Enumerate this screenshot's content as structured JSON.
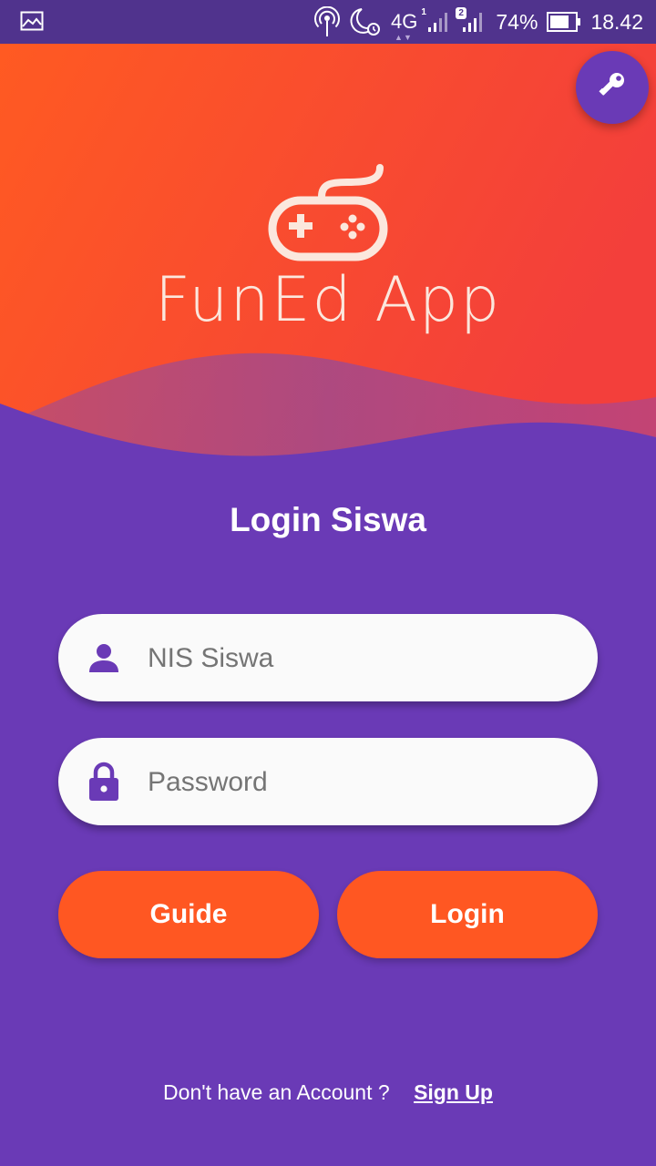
{
  "status_bar": {
    "network": "4G",
    "sim1": "1",
    "sim2": "2",
    "battery": "74%",
    "time": "18.42",
    "icons": [
      "image-icon",
      "hotspot-icon",
      "moon-alarm-icon",
      "signal-icon",
      "battery-icon"
    ]
  },
  "header": {
    "app_name": "FunEd App",
    "logo_icon": "gamepad-icon",
    "fab_icon": "key-icon"
  },
  "login": {
    "title": "Login Siswa",
    "nis_placeholder": "NIS Siswa",
    "password_placeholder": "Password",
    "guide_label": "Guide",
    "login_label": "Login"
  },
  "footer": {
    "prompt": "Don't have an Account ?",
    "signup_label": "Sign Up"
  },
  "colors": {
    "primary": "#6a3ab6",
    "status_bar": "#50338d",
    "accent": "#ff5722",
    "field_bg": "#fafafa"
  }
}
